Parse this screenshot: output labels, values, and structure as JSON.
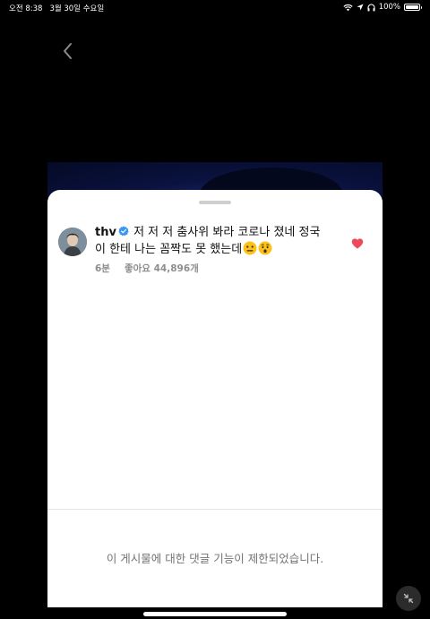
{
  "status_bar": {
    "time": "오전 8:38",
    "date": "3월 30일 수요일",
    "battery_percent": "100%",
    "battery_level": 1.0
  },
  "comment": {
    "username": "thv",
    "text": "저 저 저 춤사위 봐라 코로나 졌네 정국이 한테 나는 꼼짝도 못 했는데",
    "emojis": [
      "neutral-face-emoji",
      "hushed-face-emoji"
    ],
    "time_ago": "6분",
    "likes": "좋아요 44,896개",
    "liked": true
  },
  "footer": {
    "restricted_notice": "이 게시물에 대한 댓글 기능이 제한되었습니다."
  },
  "colors": {
    "like_red": "#ed4956",
    "verified_blue": "#3897f0",
    "sheet_bg": "#ffffff",
    "page_bg": "#000000"
  }
}
